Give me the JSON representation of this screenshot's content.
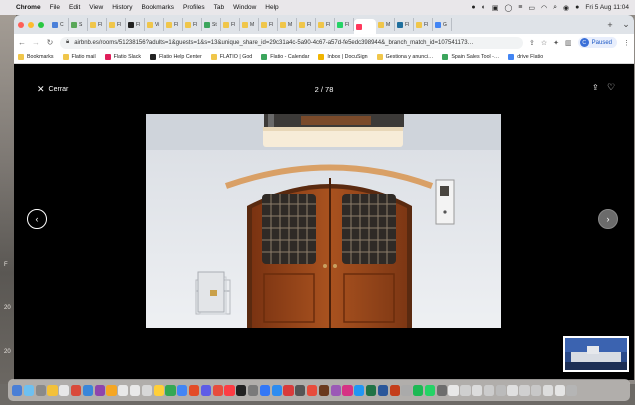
{
  "menubar": {
    "app": "Chrome",
    "items": [
      "File",
      "Edit",
      "View",
      "History",
      "Bookmarks",
      "Profiles",
      "Tab",
      "Window",
      "Help"
    ],
    "clock": "Fri 5 Aug  11:04"
  },
  "desktop": {
    "side_numbers": [
      "F",
      "20",
      "20"
    ]
  },
  "browser": {
    "tabs": [
      {
        "label": "C",
        "color": "#4a80d9"
      },
      {
        "label": "S",
        "color": "#5aa85a"
      },
      {
        "label": "Fl",
        "color": "#f0c64a"
      },
      {
        "label": "Fl",
        "color": "#f0c64a"
      },
      {
        "label": "Fl",
        "color": "#222222"
      },
      {
        "label": "Vi",
        "color": "#f0c64a"
      },
      {
        "label": "Fl",
        "color": "#f0c64a"
      },
      {
        "label": "Fl",
        "color": "#f0c64a"
      },
      {
        "label": "St",
        "color": "#3ba55c"
      },
      {
        "label": "Fl",
        "color": "#f0c64a"
      },
      {
        "label": "M",
        "color": "#f0c64a"
      },
      {
        "label": "Fl",
        "color": "#f0c64a"
      },
      {
        "label": "M",
        "color": "#f0c64a"
      },
      {
        "label": "Fl",
        "color": "#f0c64a"
      },
      {
        "label": "Fl",
        "color": "#f0c64a"
      },
      {
        "label": "Fl",
        "color": "#25d366"
      },
      {
        "label": "",
        "color": "#ff385c",
        "active": true
      },
      {
        "label": "M",
        "color": "#f0c64a"
      },
      {
        "label": "Fl",
        "color": "#1f6f9e"
      },
      {
        "label": "Fl",
        "color": "#f0c64a"
      },
      {
        "label": "G",
        "color": "#4285f4"
      }
    ],
    "new_tab": "+",
    "tab_menu": "⌄",
    "url": "airbnb.es/rooms/51238156?adults=1&guests=1&s=13&unique_share_id=29c31a4c-5a90-4c67-a57d-fe5edc398944&_branch_match_id=107541173…",
    "profile_label": "Paused",
    "profile_initial": "C",
    "bookmarks": [
      {
        "label": "Bookmarks",
        "color": "#f0c64a"
      },
      {
        "label": "Flatio mail",
        "color": "#f0c64a"
      },
      {
        "label": "Flatio Slack",
        "color": "#e01e5a"
      },
      {
        "label": "Flatio Help Center",
        "color": "#222222"
      },
      {
        "label": "FLATIO | God",
        "color": "#f0c64a"
      },
      {
        "label": "Flatio - Calendar",
        "color": "#3ba55c"
      },
      {
        "label": "Inbox | DocuSign",
        "color": "#f0b400"
      },
      {
        "label": "Gestiona y anunci…",
        "color": "#f0c64a"
      },
      {
        "label": "Spain Sales Tool -…",
        "color": "#3ba55c"
      },
      {
        "label": "drive Flatio",
        "color": "#4285f4"
      }
    ]
  },
  "viewer": {
    "close_label": "Cerrar",
    "counter": "2 / 78"
  },
  "dock": {
    "apps": [
      "#4a7fd6",
      "#6ec0f0",
      "#8a8a8a",
      "#f3c13a",
      "#e8e8e8",
      "#d94a3a",
      "#3a86d9",
      "#8e44ad",
      "#f5a623",
      "#e8e8e8",
      "#e9e9e9",
      "#d8d8d8",
      "#ffcf3a",
      "#34a853",
      "#4285f4",
      "#e34c26",
      "#5e5ce6",
      "#e74c3c",
      "#fc3c44",
      "#222222",
      "#7a7a7a",
      "#3478f6",
      "#2d8cf0",
      "#d93b3b",
      "#555555",
      "#e74c3c",
      "#6b3a1f",
      "#9b59b6",
      "#d63384",
      "#2196f3",
      "#217346",
      "#2b579a",
      "#c43e1c",
      "#aaaaaa",
      "#1db954",
      "#25d366",
      "#6d6d6d",
      "#e8e8e8",
      "#cfcfcf",
      "#dcdcdc",
      "#cccccc",
      "#bbbbbb",
      "#e0e0e0",
      "#d0d0d0",
      "#c8c8c8",
      "#dddddd",
      "#e5e5e5",
      "#b5b5b5"
    ]
  }
}
